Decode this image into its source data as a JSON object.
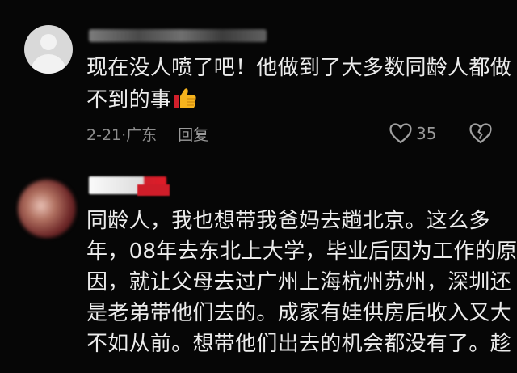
{
  "comments": [
    {
      "text_lines": [
        "现在没人喷了吧！他做到了大多数同龄人都做",
        "不到的事"
      ],
      "emoji": "thumbs-up-emoji",
      "date": "2-21",
      "location": "广东",
      "reply_label": "回复",
      "like_count": "35"
    },
    {
      "text_lines": [
        "同龄人，我也想带我爸妈去趟北京。这么多",
        "年，08年去东北上大学，毕业后因为工作的原",
        "因，就让父母去过广州上海杭州苏州，深圳还",
        "是老弟带他们去的。成家有娃供房后收入又大",
        "不如从前。想带他们出去的机会都没有了。趁"
      ]
    }
  ],
  "colors": {
    "background": "#060606",
    "text": "#ececec",
    "meta": "#8e8e8e",
    "emoji_yellow": "#f6b31d",
    "badge_red": "#d11f2b"
  },
  "icons": [
    "heart-outline-icon",
    "broken-heart-icon",
    "default-avatar-icon"
  ]
}
